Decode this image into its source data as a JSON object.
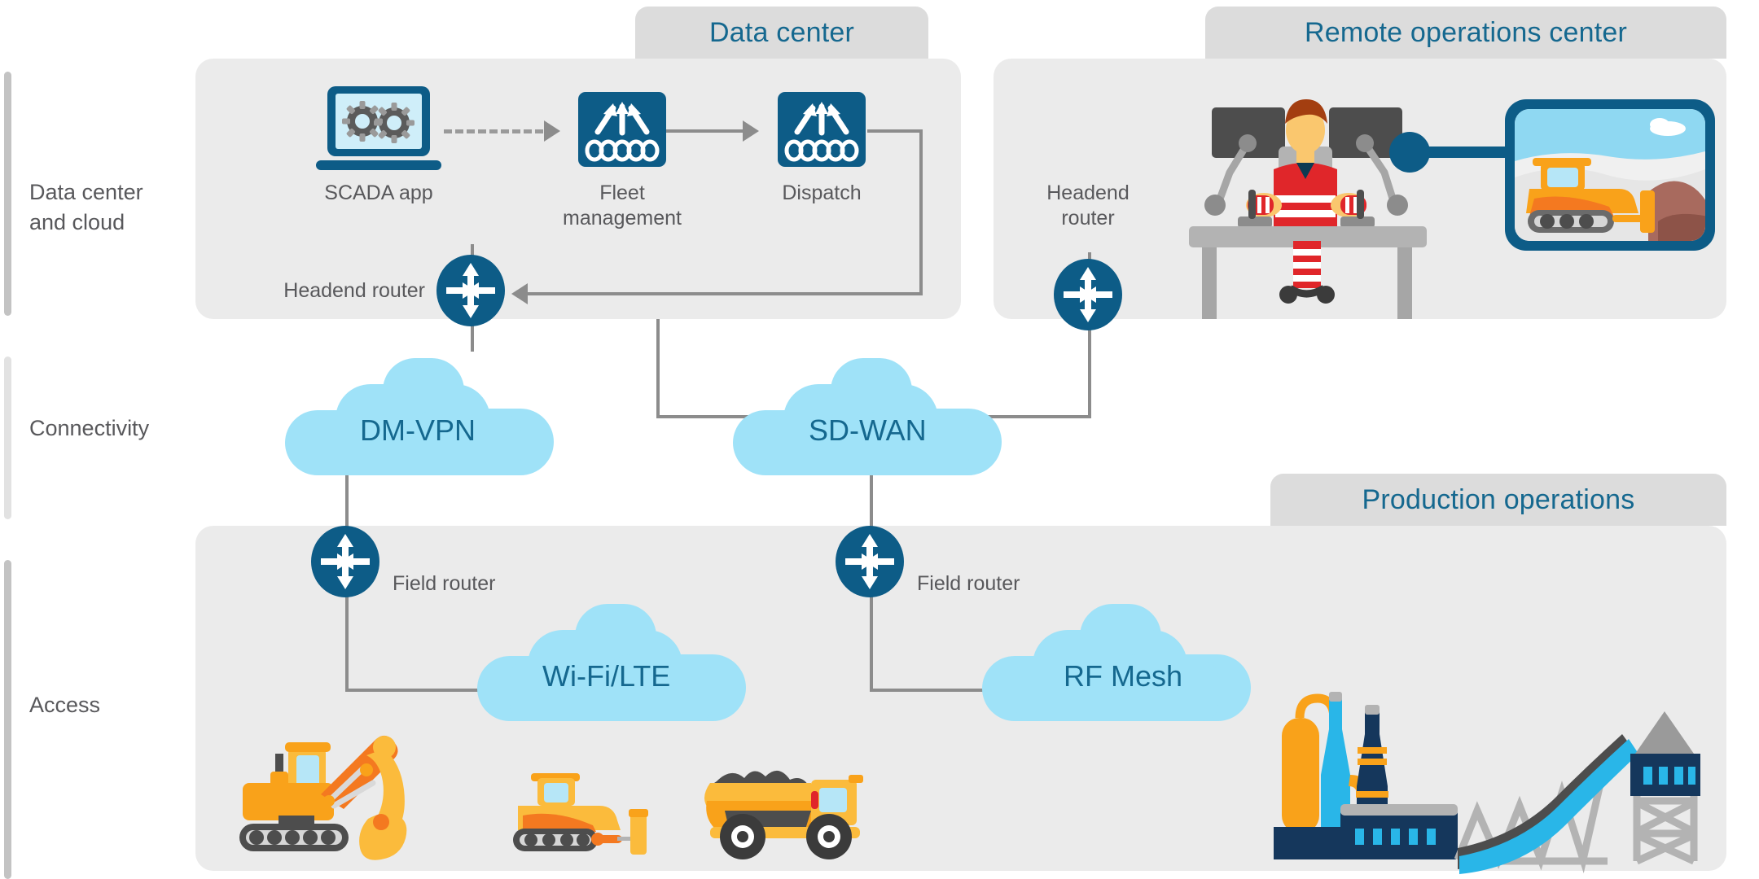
{
  "rows": [
    {
      "label": "Data center\nand cloud"
    },
    {
      "label": "Connectivity"
    },
    {
      "label": "Access"
    }
  ],
  "zones": [
    {
      "id": "data-center",
      "title": "Data center"
    },
    {
      "id": "remote-ops",
      "title": "Remote operations center"
    },
    {
      "id": "production-ops",
      "title": "Production operations"
    }
  ],
  "nodes": {
    "scada": {
      "label": "SCADA app",
      "icon": "laptop-gears-icon"
    },
    "fleet": {
      "label": "Fleet\nmanagement",
      "icon": "network-switch-icon"
    },
    "dispatch": {
      "label": "Dispatch",
      "icon": "network-switch-icon"
    },
    "headend_dc": {
      "label": "Headend router",
      "icon": "router-icon"
    },
    "headend_remote": {
      "label": "Headend\nrouter",
      "icon": "router-icon"
    },
    "field_router_left": {
      "label": "Field router",
      "icon": "router-icon"
    },
    "field_router_right": {
      "label": "Field router",
      "icon": "router-icon"
    }
  },
  "clouds": [
    {
      "id": "dmvpn",
      "label": "DM-VPN"
    },
    {
      "id": "sdwan",
      "label": "SD-WAN"
    },
    {
      "id": "wifilte",
      "label": "Wi-Fi/LTE"
    },
    {
      "id": "rfmesh",
      "label": "RF Mesh"
    }
  ],
  "illustrations": [
    {
      "id": "operator-workstation",
      "name": "remote-operator-illustration"
    },
    {
      "id": "video-feed",
      "name": "bulldozer-video-feed-icon"
    },
    {
      "id": "excavator",
      "name": "excavator-illustration"
    },
    {
      "id": "bulldozer",
      "name": "bulldozer-illustration"
    },
    {
      "id": "haul-truck",
      "name": "haul-truck-illustration"
    },
    {
      "id": "plant",
      "name": "processing-plant-illustration"
    }
  ],
  "colors": {
    "brand_blue": "#0d5c87",
    "title_blue": "#15688f",
    "cloud_blue": "#9fe2f8",
    "panel_gray": "#ebebeb",
    "tab_gray": "#dcdcdc",
    "line_gray": "#8c8c8c",
    "text_gray": "#58585b",
    "equip_orange": "#f9a21a",
    "vest_red": "#e0262a"
  }
}
